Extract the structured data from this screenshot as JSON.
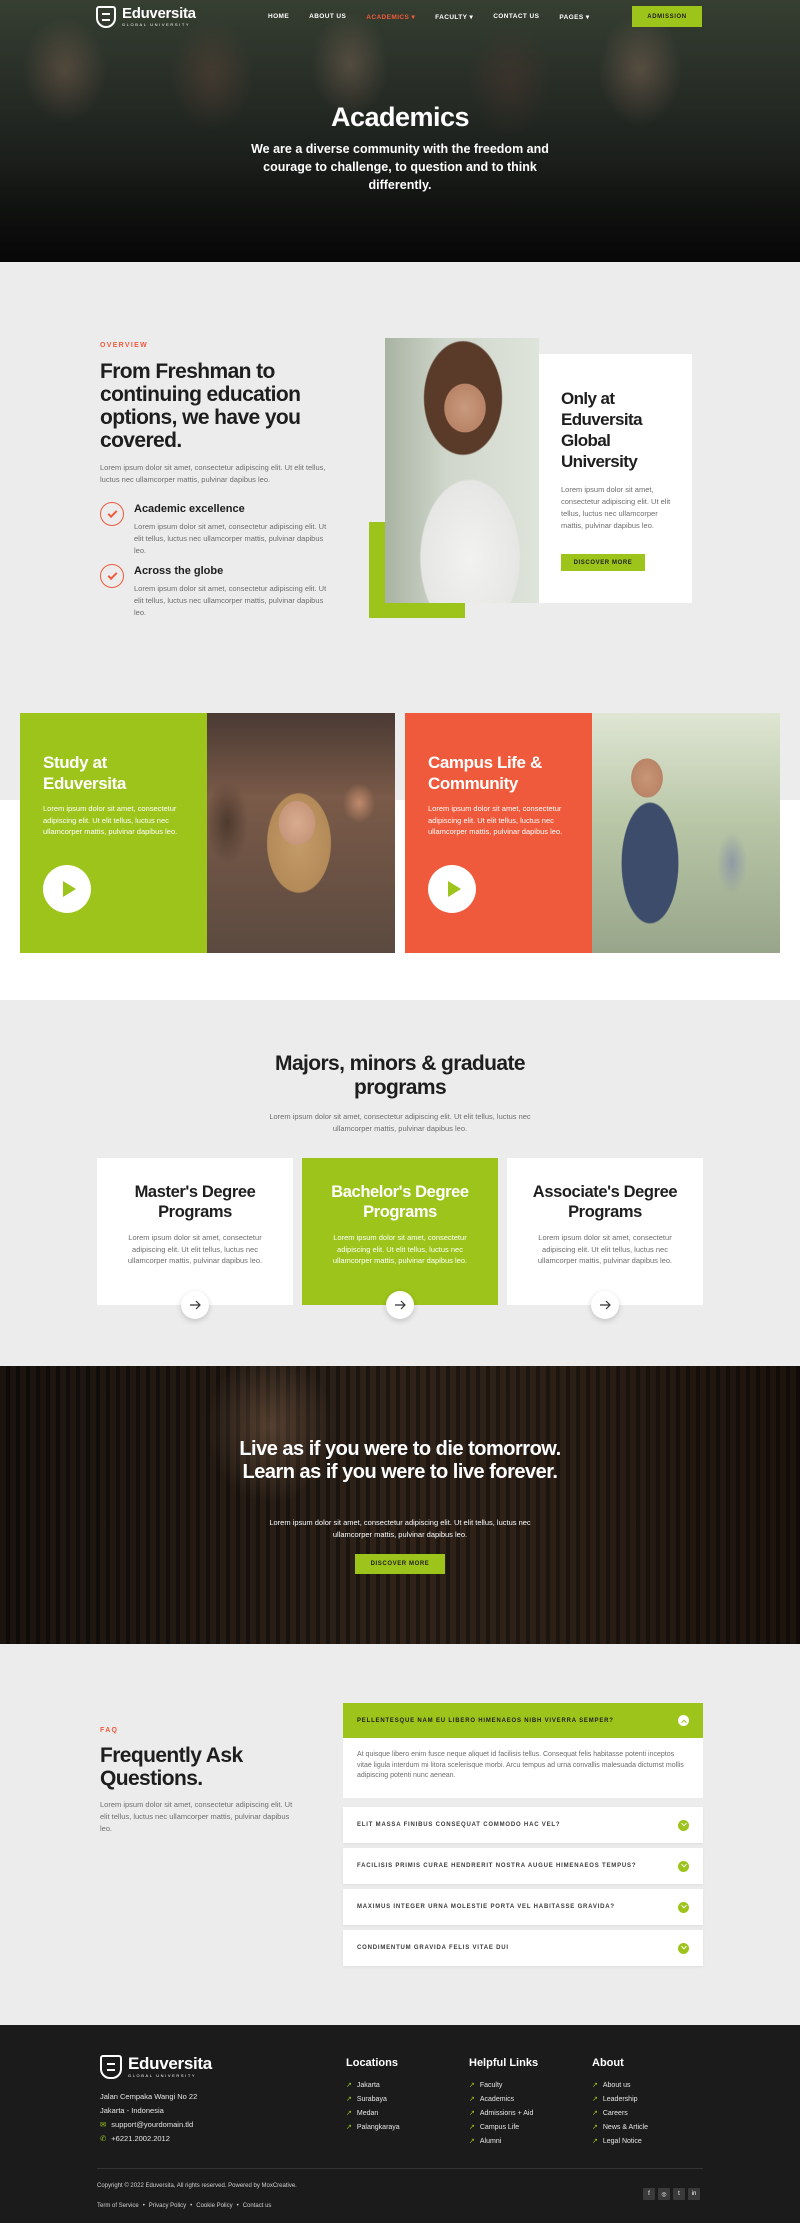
{
  "nav": {
    "logo_name": "Eduversita",
    "logo_sub": "GLOBAL UNIVERSITY",
    "items": [
      {
        "label": "HOME"
      },
      {
        "label": "ABOUT US"
      },
      {
        "label": "ACADEMICS",
        "dropdown": true,
        "active": true
      },
      {
        "label": "FACULTY",
        "dropdown": true
      },
      {
        "label": "CONTACT US"
      },
      {
        "label": "PAGES",
        "dropdown": true
      }
    ],
    "cta": "ADMISSION"
  },
  "hero": {
    "title": "Academics",
    "subtitle": "We are a diverse community with the freedom and courage to challenge, to question and to think differently."
  },
  "overview": {
    "eyebrow": "OVERVIEW",
    "title": "From Freshman to continuing education options, we have you covered.",
    "text": "Lorem ipsum dolor sit amet, consectetur adipiscing elit. Ut elit tellus, luctus nec ullamcorper mattis, pulvinar dapibus leo.",
    "features": [
      {
        "title": "Academic excellence",
        "text": "Lorem ipsum dolor sit amet, consectetur adipiscing elit. Ut elit tellus, luctus nec ullamcorper mattis, pulvinar dapibus leo."
      },
      {
        "title": "Across the globe",
        "text": "Lorem ipsum dolor sit amet, consectetur adipiscing elit. Ut elit tellus, luctus nec ullamcorper mattis, pulvinar dapibus leo."
      }
    ],
    "card": {
      "title": "Only at Eduversita Global University",
      "text": "Lorem ipsum dolor sit amet, consectetur adipiscing elit. Ut elit tellus, luctus nec ullamcorper mattis, pulvinar dapibus leo.",
      "button": "DISCOVER MORE"
    }
  },
  "promos": [
    {
      "title": "Study at Eduversita",
      "text": "Lorem ipsum dolor sit amet, consectetur adipiscing elit. Ut elit tellus, luctus nec ullamcorper mattis, pulvinar dapibus leo."
    },
    {
      "title": "Campus Life & Community",
      "text": "Lorem ipsum dolor sit amet, consectetur adipiscing elit. Ut elit tellus, luctus nec ullamcorper mattis, pulvinar dapibus leo."
    }
  ],
  "programs": {
    "title": "Majors, minors & graduate programs",
    "text": "Lorem ipsum dolor sit amet, consectetur adipiscing elit. Ut elit tellus, luctus nec ullamcorper mattis, pulvinar dapibus leo.",
    "cards": [
      {
        "title": "Master's Degree Programs",
        "text": "Lorem ipsum dolor sit amet, consectetur adipiscing elit. Ut elit tellus, luctus nec ullamcorper mattis, pulvinar dapibus leo."
      },
      {
        "title": "Bachelor's Degree Programs",
        "text": "Lorem ipsum dolor sit amet, consectetur adipiscing elit. Ut elit tellus, luctus nec ullamcorper mattis, pulvinar dapibus leo."
      },
      {
        "title": "Associate's Degree Programs",
        "text": "Lorem ipsum dolor sit amet, consectetur adipiscing elit. Ut elit tellus, luctus nec ullamcorper mattis, pulvinar dapibus leo."
      }
    ]
  },
  "quote": {
    "title": "Live as if you were to die tomorrow. Learn as if you were to live forever.",
    "text": "Lorem ipsum dolor sit amet, consectetur adipiscing elit. Ut elit tellus, luctus nec ullamcorper mattis, pulvinar dapibus leo.",
    "button": "DISCOVER MORE"
  },
  "faq": {
    "eyebrow": "FAQ",
    "title": "Frequently Ask Questions.",
    "text": "Lorem ipsum dolor sit amet, consectetur adipiscing elit. Ut elit tellus, luctus nec ullamcorper mattis, pulvinar dapibus leo.",
    "items": [
      {
        "q": "PELLENTESQUE NAM EU LIBERO HIMENAEOS NIBH VIVERRA SEMPER?",
        "a": "At quisque libero enim fusce neque aliquet id facilisis tellus. Consequat felis habitasse potenti inceptos vitae ligula interdum mi litora scelerisque morbi. Arcu tempus ad urna convallis malesuada dictumst mollis adipiscing potenti nunc aenean.",
        "open": true
      },
      {
        "q": "ELIT MASSA FINIBUS CONSEQUAT COMMODO HAC VEL?"
      },
      {
        "q": "FACILISIS PRIMIS CURAE HENDRERIT NOSTRA AUGUE HIMENAEOS TEMPUS?"
      },
      {
        "q": "MAXIMUS INTEGER URNA MOLESTIE PORTA VEL HABITASSE GRAVIDA?"
      },
      {
        "q": "CONDIMENTUM GRAVIDA FELIS VITAE DUI"
      }
    ]
  },
  "footer": {
    "logo_name": "Eduversita",
    "logo_sub": "GLOBAL UNIVERSITY",
    "address1": "Jalan Cempaka Wangi No 22",
    "address2": "Jakarta - Indonesia",
    "email": "support@yourdomain.tld",
    "phone": "+6221.2002.2012",
    "columns": [
      {
        "title": "Locations",
        "links": [
          "Jakarta",
          "Surabaya",
          "Medan",
          "Palangkaraya"
        ]
      },
      {
        "title": "Helpful Links",
        "links": [
          "Faculty",
          "Academics",
          "Admissions + Aid",
          "Campus Life",
          "Alumni"
        ]
      },
      {
        "title": "About",
        "links": [
          "About us",
          "Leadership",
          "Careers",
          "News & Article",
          "Legal Notice"
        ]
      }
    ],
    "copyright": "Copyright © 2022 Eduversita, All rights reserved. Powered by MoxCreative.",
    "legal": [
      "Term of Service",
      "Privacy Policy",
      "Cookie Policy",
      "Contact us"
    ],
    "social": [
      "f",
      "◎",
      "t",
      "in"
    ]
  },
  "colors": {
    "accent_green": "#9dc41b",
    "accent_orange": "#f05a3c",
    "dark": "#1b1b1b",
    "light_bg": "#ececec"
  },
  "icons": [
    "logo-shield-icon",
    "chevron-down-icon",
    "check-circle-icon",
    "play-icon",
    "arrow-right-icon",
    "faq-toggle-icon",
    "email-icon",
    "phone-icon",
    "facebook-icon",
    "instagram-icon",
    "twitter-icon",
    "linkedin-icon"
  ]
}
